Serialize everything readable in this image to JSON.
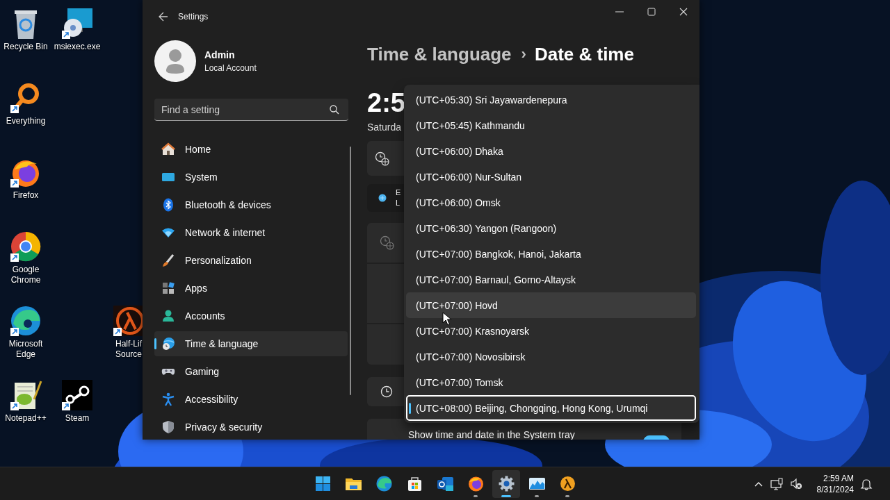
{
  "desktop_icons": [
    {
      "lines": [
        "Recycle Bin"
      ],
      "shortcut": false
    },
    {
      "lines": [
        "msiexec.exe"
      ],
      "shortcut": true
    },
    {
      "lines": [
        "Everything"
      ],
      "shortcut": true
    },
    {
      "lines": [
        "Firefox"
      ],
      "shortcut": true
    },
    {
      "lines": [
        "Google",
        "Chrome"
      ],
      "shortcut": true
    },
    {
      "lines": [
        "Microsoft",
        "Edge"
      ],
      "shortcut": true
    },
    {
      "lines": [
        "Half-Lif",
        "Source"
      ],
      "shortcut": true
    },
    {
      "lines": [
        "Notepad++"
      ],
      "shortcut": true
    },
    {
      "lines": [
        "Steam"
      ],
      "shortcut": true
    }
  ],
  "settings_window": {
    "title": "Settings",
    "user": {
      "name": "Admin",
      "account_type": "Local Account"
    },
    "search": {
      "placeholder": "Find a setting"
    },
    "nav_items": [
      {
        "label": "Home",
        "selected": false
      },
      {
        "label": "System",
        "selected": false
      },
      {
        "label": "Bluetooth & devices",
        "selected": false
      },
      {
        "label": "Network & internet",
        "selected": false
      },
      {
        "label": "Personalization",
        "selected": false
      },
      {
        "label": "Apps",
        "selected": false
      },
      {
        "label": "Accounts",
        "selected": false
      },
      {
        "label": "Time & language",
        "selected": true
      },
      {
        "label": "Gaming",
        "selected": false
      },
      {
        "label": "Accessibility",
        "selected": false
      },
      {
        "label": "Privacy & security",
        "selected": false
      }
    ],
    "breadcrumb": {
      "parent": "Time & language",
      "separator": "›",
      "current": "Date & time"
    },
    "clock": "2:5",
    "date": "Saturda",
    "card_texts": [
      "E",
      "L"
    ],
    "tray_setting": {
      "label": "Show time and date in the System tray",
      "on": true
    }
  },
  "timezone_dropdown": {
    "items": [
      {
        "label": "(UTC+05:30) Sri Jayawardenepura",
        "selected": false,
        "hovered": false
      },
      {
        "label": "(UTC+05:45) Kathmandu",
        "selected": false,
        "hovered": false
      },
      {
        "label": "(UTC+06:00) Dhaka",
        "selected": false,
        "hovered": false
      },
      {
        "label": "(UTC+06:00) Nur-Sultan",
        "selected": false,
        "hovered": false
      },
      {
        "label": "(UTC+06:00) Omsk",
        "selected": false,
        "hovered": false
      },
      {
        "label": "(UTC+06:30) Yangon (Rangoon)",
        "selected": false,
        "hovered": false
      },
      {
        "label": "(UTC+07:00) Bangkok, Hanoi, Jakarta",
        "selected": false,
        "hovered": false
      },
      {
        "label": "(UTC+07:00) Barnaul, Gorno-Altaysk",
        "selected": false,
        "hovered": false
      },
      {
        "label": "(UTC+07:00) Hovd",
        "selected": false,
        "hovered": true
      },
      {
        "label": "(UTC+07:00) Krasnoyarsk",
        "selected": false,
        "hovered": false
      },
      {
        "label": "(UTC+07:00) Novosibirsk",
        "selected": false,
        "hovered": false
      },
      {
        "label": "(UTC+07:00) Tomsk",
        "selected": false,
        "hovered": false
      },
      {
        "label": "(UTC+08:00) Beijing, Chongqing, Hong Kong, Urumqi",
        "selected": true,
        "hovered": false
      }
    ]
  },
  "taskbar": {
    "apps": [
      {
        "running": false,
        "active": false
      },
      {
        "running": false,
        "active": false
      },
      {
        "running": false,
        "active": false
      },
      {
        "running": false,
        "active": false
      },
      {
        "running": false,
        "active": false
      },
      {
        "running": true,
        "active": false
      },
      {
        "running": true,
        "active": true
      },
      {
        "running": true,
        "active": false
      },
      {
        "running": true,
        "active": false
      }
    ],
    "time": "2:59 AM",
    "date": "8/31/2024"
  }
}
